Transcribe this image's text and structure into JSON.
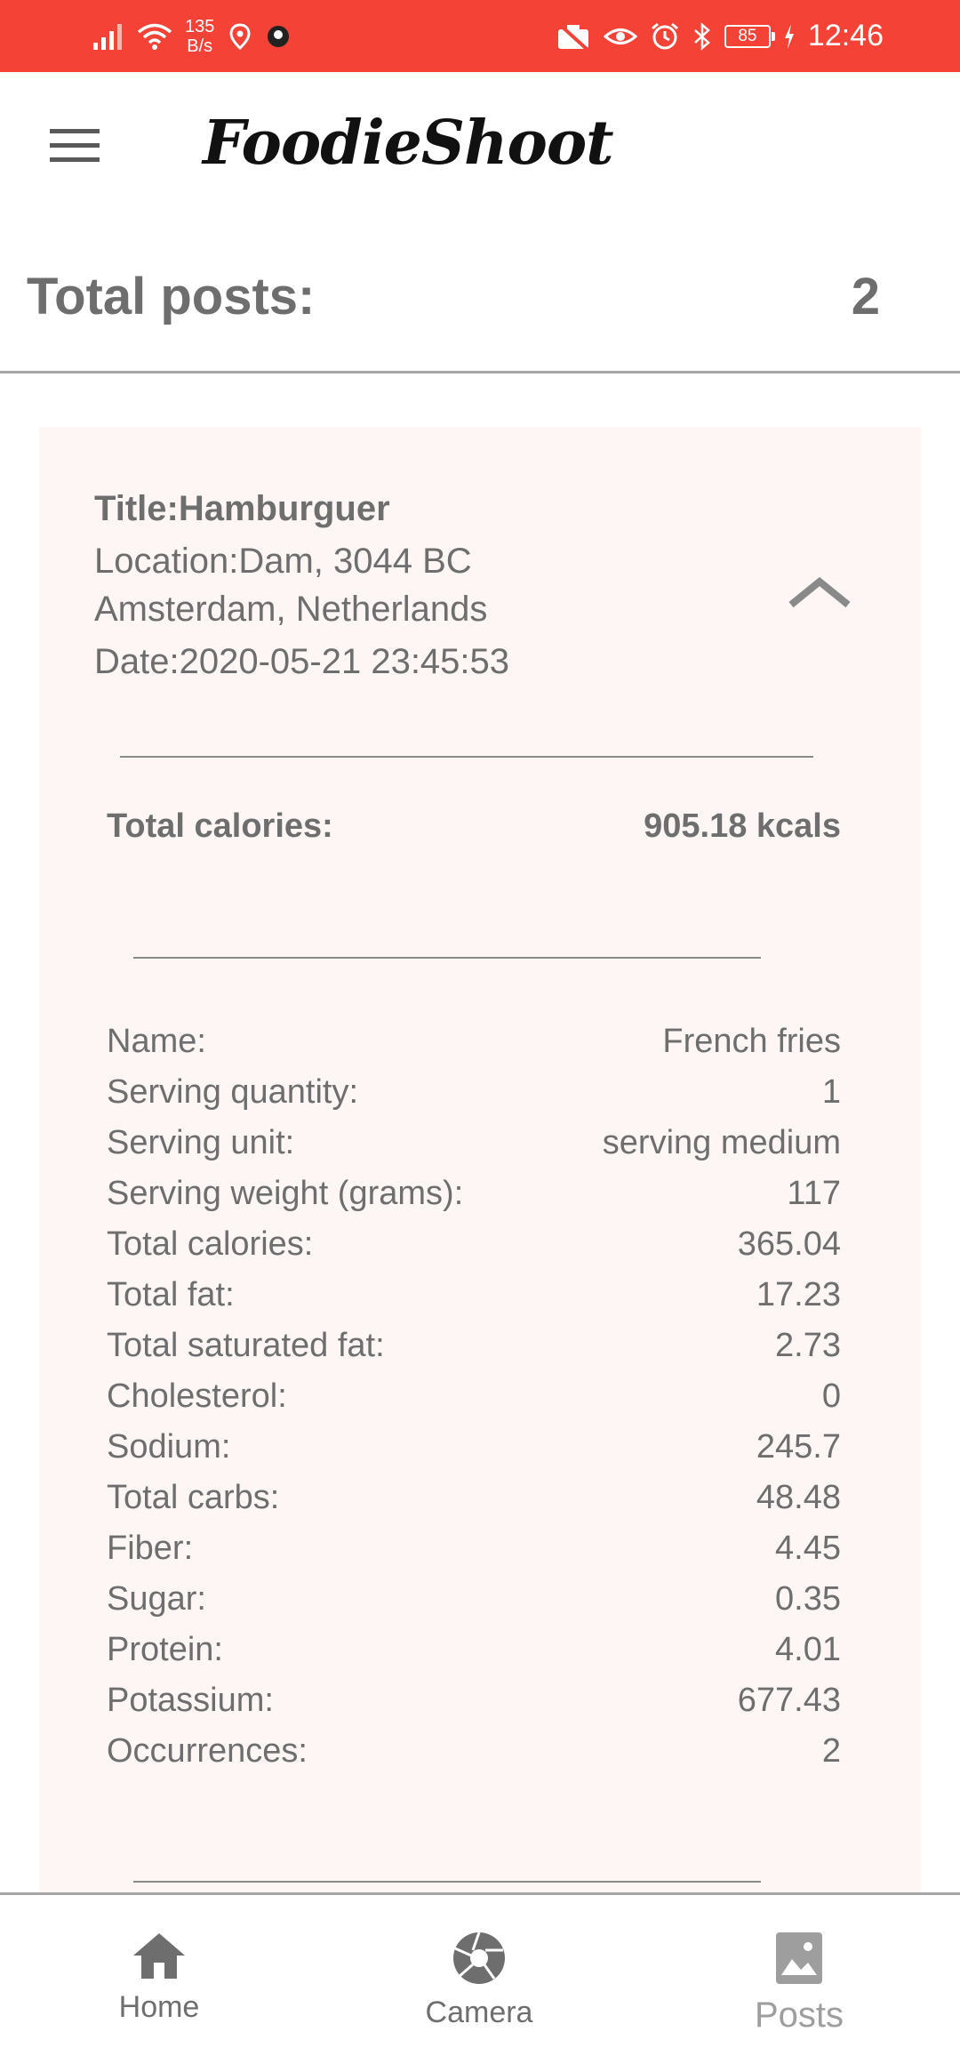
{
  "status_bar": {
    "net_speed_value": "135",
    "net_speed_unit": "B/s",
    "battery": "85",
    "time": "12:46"
  },
  "app_bar": {
    "title": "FoodieShoot"
  },
  "summary": {
    "label": "Total posts:",
    "value": "2"
  },
  "post": {
    "title": "Title:Hamburguer",
    "location": "Location:Dam, 3044 BC Amsterdam, Netherlands",
    "date": "Date:2020-05-21 23:45:53",
    "total_calories_label": "Total calories:",
    "total_calories_value": "905.18 kcals",
    "food_item": {
      "rows": [
        {
          "label": "Name:",
          "value": "French fries"
        },
        {
          "label": "Serving quantity:",
          "value": "1"
        },
        {
          "label": "Serving unit:",
          "value": "serving medium"
        },
        {
          "label": "Serving weight (grams):",
          "value": "117"
        },
        {
          "label": "Total calories:",
          "value": "365.04"
        },
        {
          "label": "Total fat:",
          "value": "17.23"
        },
        {
          "label": "Total saturated fat:",
          "value": "2.73"
        },
        {
          "label": "Cholesterol:",
          "value": "0"
        },
        {
          "label": "Sodium:",
          "value": "245.7"
        },
        {
          "label": "Total carbs:",
          "value": "48.48"
        },
        {
          "label": "Fiber:",
          "value": "4.45"
        },
        {
          "label": "Sugar:",
          "value": "0.35"
        },
        {
          "label": "Protein:",
          "value": "4.01"
        },
        {
          "label": "Potassium:",
          "value": "677.43"
        },
        {
          "label": "Occurrences:",
          "value": "2"
        }
      ]
    }
  },
  "bottom_nav": {
    "items": [
      {
        "label": "Home",
        "icon": "home-icon"
      },
      {
        "label": "Camera",
        "icon": "camera-aperture-icon"
      },
      {
        "label": "Posts",
        "icon": "image-icon"
      }
    ]
  },
  "colors": {
    "status_bar": "#f44336",
    "card_background": "#fdf6f5",
    "text": "#6e6e6e",
    "inactive_nav": "#9e9e9e"
  }
}
